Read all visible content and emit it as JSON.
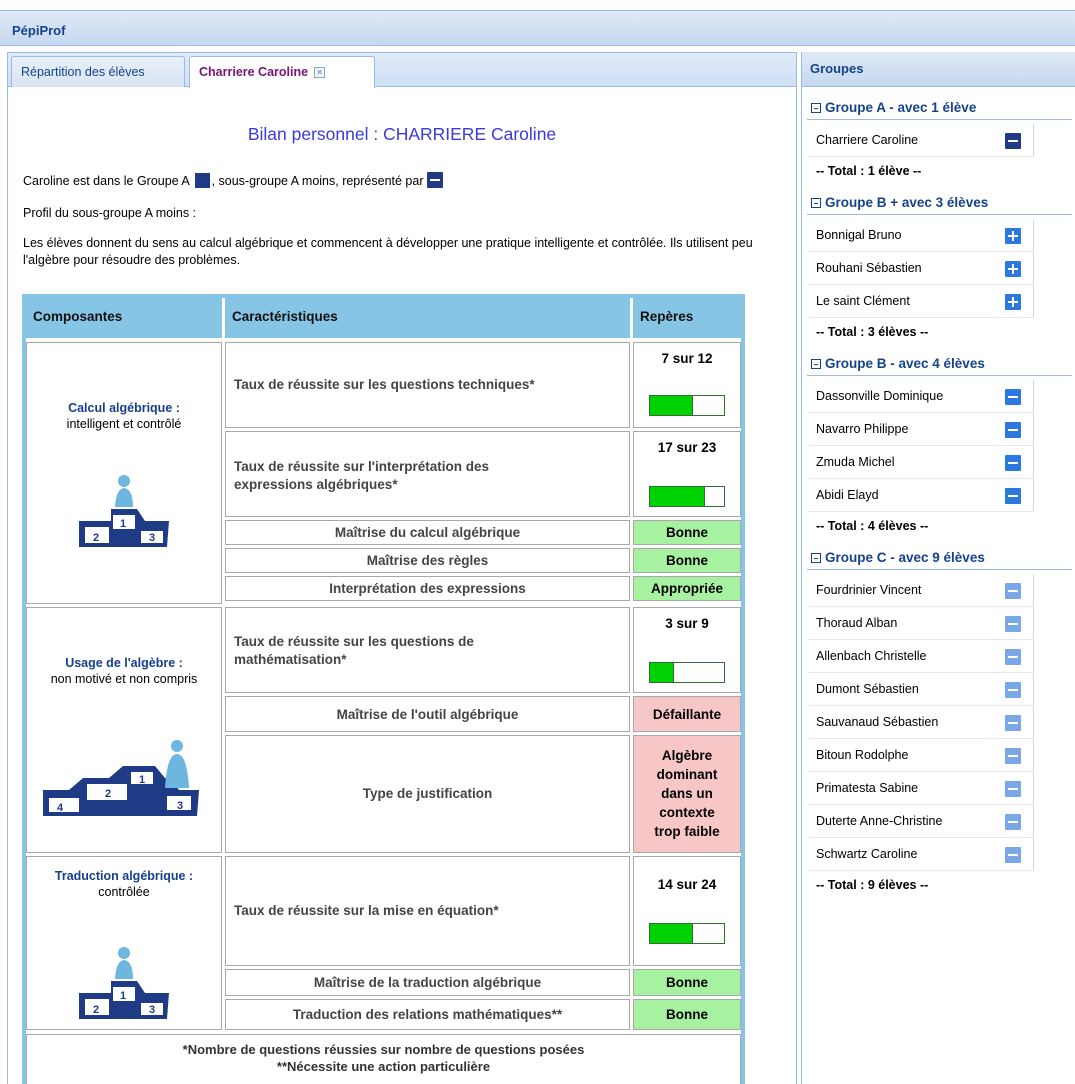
{
  "app": {
    "title": "PépiProf"
  },
  "tabs": [
    {
      "label": "Répartition des élèves",
      "active": false
    },
    {
      "label": "Charriere Caroline",
      "active": true,
      "close_icon": "close-icon"
    }
  ],
  "bilan": {
    "title": "Bilan personnel : CHARRIERE Caroline",
    "group_line": {
      "part1": "Caroline est dans le  Groupe A",
      "part2": ", sous-groupe  A moins, représenté par"
    },
    "profile_label": "Profil du sous-groupe  A moins :",
    "description": "Les élèves donnent du sens au calcul algébrique et commencent à développer une pratique intelligente et contrôlée. Ils utilisent peu l'algèbre pour résoudre des problèmes.",
    "table": {
      "headers": [
        "Composantes",
        "Caractéristiques",
        "Repères"
      ],
      "components": [
        {
          "title": "Calcul algébrique :",
          "subtitle": "intelligent et contrôlé",
          "podium_icon": "podium-icon",
          "rates": [
            {
              "label": "Taux de réussite sur les questions techniques*",
              "score": "7 sur 12",
              "fraction": 0.58
            },
            {
              "label": "Taux de réussite sur l'interprétation des expressions algébriques*",
              "score": "17 sur 23",
              "fraction": 0.74
            }
          ],
          "criteria": [
            {
              "label": "Maîtrise du calcul algébrique",
              "value": "Bonne",
              "status": "good"
            },
            {
              "label": "Maîtrise des règles",
              "value": "Bonne",
              "status": "good"
            },
            {
              "label": "Interprétation des expressions",
              "value": "Appropriée",
              "status": "good"
            }
          ]
        },
        {
          "title": "Usage de l'algèbre :",
          "subtitle": "non motivé et non compris",
          "podium_icon": "podium-icon",
          "rates": [
            {
              "label": "Taux de réussite sur les questions de mathématisation*",
              "score": "3 sur 9",
              "fraction": 0.33
            }
          ],
          "criteria": [
            {
              "label": "Maîtrise de l'outil algébrique",
              "value": "Défaillante",
              "status": "bad"
            },
            {
              "label": "Type de justification",
              "value_lines": [
                "Algèbre",
                "dominant",
                "dans un",
                "contexte",
                "trop faible"
              ],
              "status": "bad"
            }
          ]
        },
        {
          "title": "Traduction algébrique :",
          "subtitle": "contrôlée",
          "podium_icon": "podium-icon",
          "rates": [
            {
              "label": "Taux de réussite sur la mise en équation*",
              "score": "14 sur 24",
              "fraction": 0.58
            }
          ],
          "criteria": [
            {
              "label": "Maîtrise de la traduction algébrique",
              "value": "Bonne",
              "status": "good"
            },
            {
              "label": "Traduction des relations mathématiques**",
              "value": "Bonne",
              "status": "good"
            }
          ]
        }
      ],
      "footnotes": [
        "*Nombre de questions réussies sur nombre de questions posées",
        "**Nécessite une action particulière"
      ]
    }
  },
  "groups_panel": {
    "title": "Groupes",
    "groups": [
      {
        "header": "Groupe A - avec 1  élève",
        "members": [
          "Charriere Caroline"
        ],
        "icon": "minus-dark",
        "total": "-- Total :  1 élève --"
      },
      {
        "header": "Groupe B + avec 3  élèves",
        "members": [
          "Bonnigal Bruno",
          "Rouhani Sébastien",
          "Le saint Clément"
        ],
        "icon": "plus-blue",
        "total": "-- Total :  3 élèves --"
      },
      {
        "header": "Groupe B - avec 4  élèves",
        "members": [
          "Dassonville Dominique",
          "Navarro Philippe",
          "Zmuda Michel",
          "Abidi Elayd"
        ],
        "icon": "minus-blue",
        "total": "-- Total :  4 élèves --"
      },
      {
        "header": "Groupe C - avec 9  élèves",
        "members": [
          "Fourdrinier Vincent",
          "Thoraud Alban",
          "Allenbach Christelle",
          "Dumont Sébastien",
          "Sauvanaud Sébastien",
          "Bitoun Rodolphe",
          "Primatesta Sabine",
          "Duterte Anne-Christine",
          "Schwartz Caroline"
        ],
        "icon": "minus-light",
        "total": "-- Total :  9 élèves --"
      }
    ]
  },
  "colors": {
    "header_blue": "#87c5e6",
    "good": "#a6f2a0",
    "bad": "#f7c6c6",
    "bar_fill": "#00d100",
    "group_dark": "#1f3b85"
  }
}
